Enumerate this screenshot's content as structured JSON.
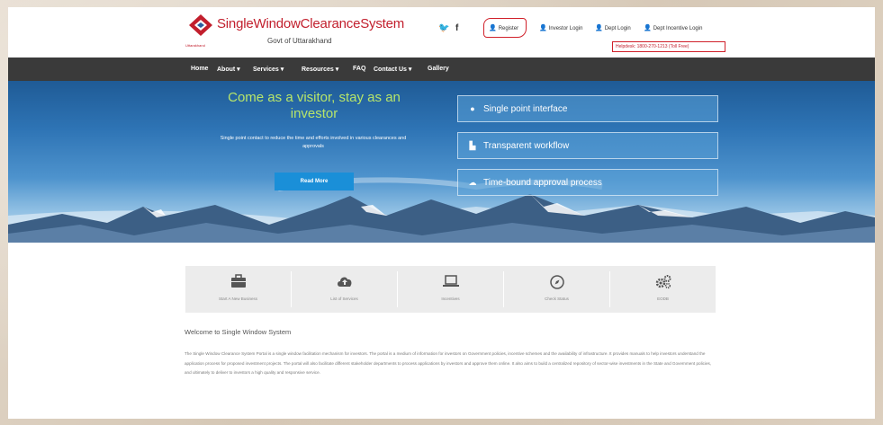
{
  "header": {
    "title": "SingleWindowClearanceSystem",
    "subtitle": "Govt of Uttarakhand",
    "logo_tagline": "Uttarakhand",
    "brand_color": "#c21f2d",
    "social": {
      "twitter_icon": "twitter-icon",
      "facebook_icon": "facebook-icon"
    },
    "top_links": [
      {
        "label": "Register",
        "icon": "user-icon"
      },
      {
        "label": "Investor Login",
        "icon": "user-icon"
      },
      {
        "label": "Dept Login",
        "icon": "user-icon"
      },
      {
        "label": "Dept Incentive Login",
        "icon": "user-icon"
      }
    ],
    "helpdesk": "Helpdesk: 1800-270-1213 (Toll Free)"
  },
  "nav": {
    "items": [
      "Home",
      "About ▾",
      "Services ▾",
      "Resources ▾",
      "FAQ",
      "Contact Us ▾",
      "Gallery"
    ],
    "background": "#3a3a3a"
  },
  "hero": {
    "title": "Come as a visitor, stay as an investor",
    "text": "Single point contact to reduce the time and efforts involved in various clearances and approvals",
    "button": "Read More",
    "features": [
      {
        "label": "Single point interface",
        "icon": "globe-icon"
      },
      {
        "label": "Transparent workflow",
        "icon": "hierarchy-icon"
      },
      {
        "label": "Time-bound approval process",
        "icon": "cloud-icon"
      }
    ]
  },
  "services": [
    {
      "label": "Start A New Business",
      "icon": "briefcase-icon"
    },
    {
      "label": "List of Services",
      "icon": "cloud-upload-icon"
    },
    {
      "label": "Incentives",
      "icon": "laptop-icon"
    },
    {
      "label": "Check Status",
      "icon": "compass-icon"
    },
    {
      "label": "EODB",
      "icon": "gears-icon"
    }
  ],
  "welcome": {
    "title": "Welcome to Single Window System",
    "body": "The Single Window Clearance System Portal is a single window facilitation mechanism for investors. The portal is a medium of information for investors on Government policies, incentive schemes and the availability of infrastructure. It provides manuals to help investors understand the application process for proposed investment projects. The portal will also facilitate different stakeholder departments to process applications by investors and approve them online. It also aims to build a centralized repository of sector-wise investments in the State and Government policies, and ultimately to deliver to investors a high quality and responsive service."
  }
}
